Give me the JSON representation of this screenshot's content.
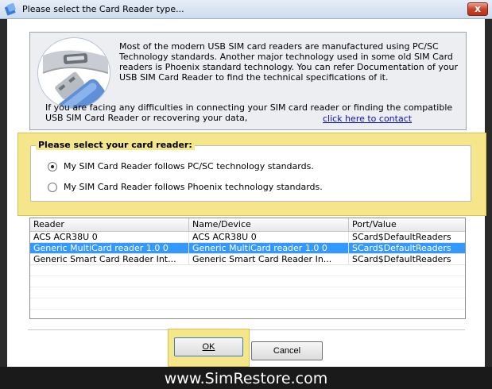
{
  "window": {
    "title": "Please select the Card Reader type...",
    "close_label": "x"
  },
  "info": {
    "text1": "Most of the modern USB SIM card readers are manufactured using PC/SC Technology standards. Another major technology used in some old SIM Card readers is Phoenix standard technology. You can refer Documentation of your USB SIM Card Reader to find the technical specifications of it.",
    "text2": "If you are facing any difficulties in connecting your SIM card reader or finding the compatible USB SIM Card Reader or recovering your data,",
    "link": "click here to contact"
  },
  "selection": {
    "legend": "Please select your card reader:",
    "options": [
      {
        "label": "My SIM Card Reader follows PC/SC technology standards.",
        "checked": true
      },
      {
        "label": "My SIM Card Reader follows Phoenix technology standards.",
        "checked": false
      }
    ]
  },
  "table": {
    "columns": [
      "Reader",
      "Name/Device",
      "Port/Value"
    ],
    "rows": [
      [
        "ACS ACR38U 0",
        "ACS ACR38U 0",
        "SCard$DefaultReaders"
      ],
      [
        "Generic MultiCard reader 1.0 0",
        "Generic MultiCard reader 1.0 0",
        "SCard$DefaultReaders"
      ],
      [
        "Generic Smart Card Reader Int...",
        "Generic Smart Card Reader In...",
        "SCard$DefaultReaders"
      ]
    ],
    "selected_row": 1
  },
  "buttons": {
    "ok": "OK",
    "cancel": "Cancel"
  },
  "footer": {
    "text": "www.SimRestore.com"
  },
  "colors": {
    "highlight": "#f5e68c",
    "selection": "#3399ff",
    "link": "#0b0bcc"
  },
  "icons": {
    "title": "app-icon",
    "close": "close-icon",
    "usb": "usb-device-icon"
  }
}
